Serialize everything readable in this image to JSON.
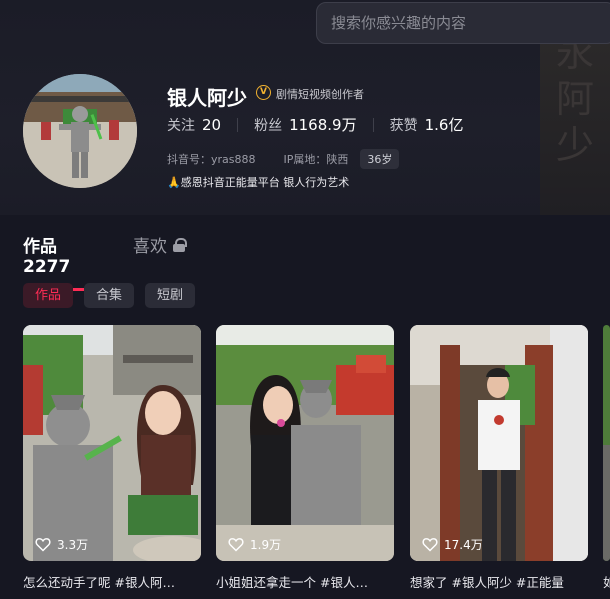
{
  "search": {
    "placeholder": "搜索你感兴趣的内容"
  },
  "watermark": [
    "永",
    "阿",
    "少"
  ],
  "profile": {
    "name": "银人阿少",
    "verified_badge": "V",
    "verified_title": "剧情短视频创作者",
    "stats": [
      {
        "label": "关注",
        "value": "20"
      },
      {
        "label": "粉丝",
        "value": "1168.9万"
      },
      {
        "label": "获赞",
        "value": "1.6亿"
      }
    ],
    "douyin_id": "抖音号：yras888",
    "ip": "IP属地：陕西",
    "age": "36岁",
    "bio": "🙏感恩抖音正能量平台 银人行为艺术"
  },
  "tabs": {
    "works": "作品 2277",
    "likes": "喜欢"
  },
  "chips": [
    "作品",
    "合集",
    "短剧"
  ],
  "videos": [
    {
      "likes": "3.3万",
      "title": "怎么还动手了呢 #银人阿…"
    },
    {
      "likes": "1.9万",
      "title": "小姐姐还拿走一个 #银人…"
    },
    {
      "likes": "17.4万",
      "title": "想家了 #银人阿少 #正能量"
    },
    {
      "likes": "",
      "title": "如"
    }
  ],
  "colors": {
    "accent": "#fe2c55",
    "verified": "#f1b230",
    "background": "#161722"
  }
}
